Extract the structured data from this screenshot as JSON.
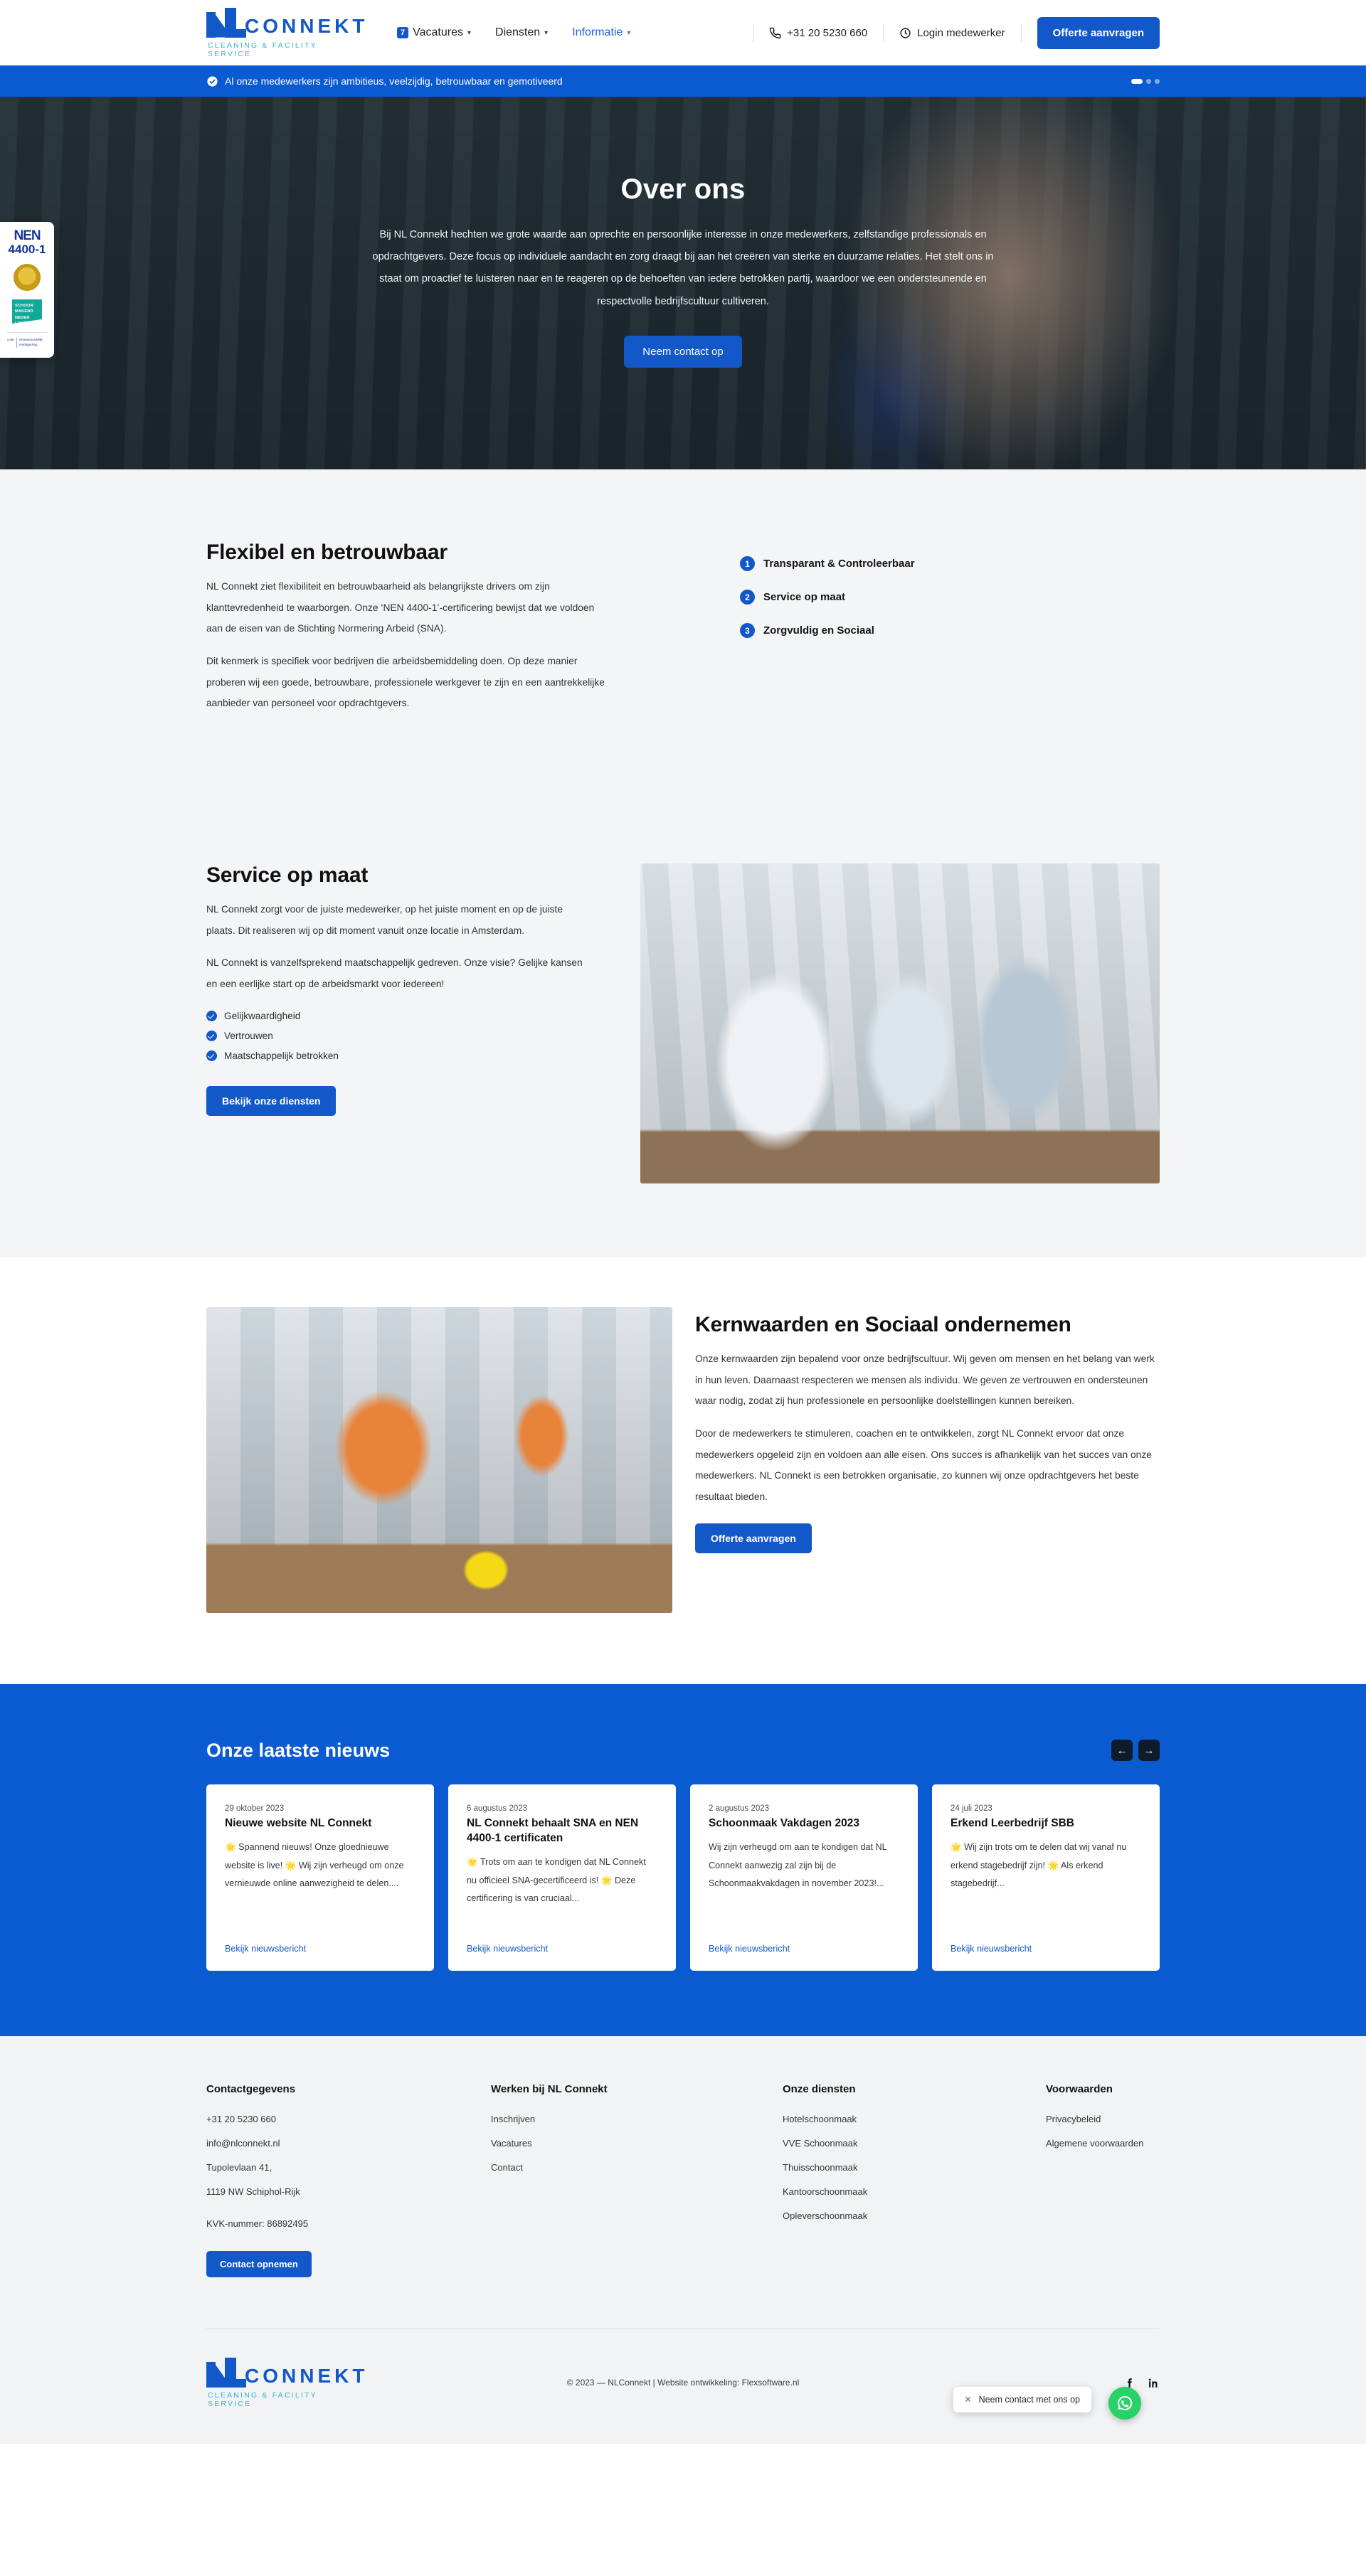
{
  "header": {
    "logo": {
      "word": "CONNEKT",
      "tagline": "CLEANING & FACILITY SERVICE"
    },
    "nav": [
      {
        "label": "Vacatures",
        "count": "7",
        "caret": "chevron-down-icon",
        "active": false
      },
      {
        "label": "Diensten",
        "count": "",
        "caret": "chevron-down-icon",
        "active": false
      },
      {
        "label": "Informatie",
        "count": "",
        "caret": "chevron-down-icon",
        "active": true
      }
    ],
    "phone": "+31 20 5230 660",
    "login": "Login medewerker",
    "cta": "Offerte aanvragen"
  },
  "banner": {
    "text": "Al onze medewerkers zijn ambitieus, veelzijdig, betrouwbaar en gemotiveerd",
    "dots": 3,
    "active_dot": 0
  },
  "cert": {
    "nen_line1": "NEN",
    "nen_line2": "4400-1",
    "teal": "SCHOON MAKEND NEDER LAND",
    "last_left": "code",
    "last_right": "verantwoordelijk marktgedrag"
  },
  "hero": {
    "title": "Over ons",
    "paragraph": "Bij NL Connekt hechten we grote waarde aan oprechte en persoonlijke interesse in onze medewerkers, zelfstandige professionals en opdrachtgevers. Deze focus op individuele aandacht en zorg draagt bij aan het creëren van sterke en duurzame relaties. Het stelt ons in staat om proactief te luisteren naar en te reageren op de behoeften van iedere betrokken partij, waardoor we een ondersteunende en respectvolle bedrijfscultuur cultiveren.",
    "button": "Neem contact op"
  },
  "flexibel": {
    "title": "Flexibel en betrouwbaar",
    "p1": "NL Connekt ziet flexibiliteit en betrouwbaarheid als belangrijkste drivers om zijn klanttevredenheid te waarborgen. Onze ‘NEN 4400-1’-certificering bewijst dat we voldoen aan de eisen van de Stichting Normering Arbeid (SNA).",
    "p2": "Dit kenmerk is specifiek voor bedrijven die arbeidsbemiddeling doen. Op deze manier proberen wij een goede, betrouwbare, professionele werkgever te zijn en een aantrekkelijke aanbieder van personeel voor opdrachtgevers.",
    "items": [
      {
        "num": "1",
        "label": "Transparant & Controleerbaar"
      },
      {
        "num": "2",
        "label": "Service op maat"
      },
      {
        "num": "3",
        "label": "Zorgvuldig en Sociaal"
      }
    ]
  },
  "service": {
    "title": "Service op maat",
    "p1": "NL Connekt zorgt voor de juiste medewerker, op het juiste moment en op de juiste plaats. Dit realiseren wij op dit moment vanuit onze locatie in Amsterdam.",
    "p2": "NL Connekt is vanzelfsprekend maatschappelijk gedreven. Onze visie? Gelijke kansen en een eerlijke start op de arbeidsmarkt voor iedereen!",
    "checks": [
      "Gelijkwaardigheid",
      "Vertrouwen",
      "Maatschappelijk betrokken"
    ],
    "button": "Bekijk onze diensten"
  },
  "kernwaarden": {
    "title": "Kernwaarden en Sociaal ondernemen",
    "p1": "Onze kernwaarden zijn bepalend voor onze bedrijfscultuur. Wij geven om mensen en het belang van werk in hun leven. Daarnaast respecteren we mensen als individu. We geven ze vertrouwen en ondersteunen waar nodig, zodat zij hun professionele en persoonlijke doelstellingen kunnen bereiken.",
    "p2": "Door de medewerkers te stimuleren, coachen en te ontwikkelen, zorgt NL Connekt ervoor dat onze medewerkers opgeleid zijn en voldoen aan alle eisen. Ons succes is afhankelijk van het succes van onze medewerkers. NL Connekt is een betrokken organisatie, zo kunnen wij onze opdrachtgevers het beste resultaat bieden.",
    "button": "Offerte aanvragen"
  },
  "news": {
    "title": "Onze laatste nieuws",
    "prev": "←",
    "next": "→",
    "link_label": "Bekijk nieuwsbericht",
    "cards": [
      {
        "date": "29 oktober 2023",
        "title": "Nieuwe website NL Connekt",
        "excerpt": "🌟 Spannend nieuws! Onze gloednieuwe website is live! 🌟 Wij zijn verheugd om onze vernieuwde online aanwezigheid te delen...."
      },
      {
        "date": "6 augustus 2023",
        "title": "NL Connekt behaalt SNA en NEN 4400-1 certificaten",
        "excerpt": "🌟 Trots om aan te kondigen dat NL Connekt nu officieel SNA-gecertificeerd is! 🌟 Deze certificering is van cruciaal..."
      },
      {
        "date": "2 augustus 2023",
        "title": "Schoonmaak Vakdagen 2023",
        "excerpt": "Wij zijn verheugd om aan te kondigen dat NL Connekt aanwezig zal zijn bij de Schoonmaakvakdagen in november 2023!..."
      },
      {
        "date": "24 juli 2023",
        "title": "Erkend Leerbedrijf SBB",
        "excerpt": "🌟 Wij zijn trots om te delen dat wij vanaf nu erkend stagebedrijf zijn! 🌟 Als erkend stagebedrijf..."
      }
    ]
  },
  "footer": {
    "contact": {
      "heading": "Contactgegevens",
      "phone": "+31 20 5230 660",
      "email": "info@nlconnekt.nl",
      "address1": "Tupolevlaan 41,",
      "address2": "1119 NW Schiphol-Rijk",
      "kvk": "KVK-nummer: 86892495",
      "button": "Contact opnemen"
    },
    "werken": {
      "heading": "Werken bij NL Connekt",
      "links": [
        "Inschrijven",
        "Vacatures",
        "Contact"
      ]
    },
    "diensten": {
      "heading": "Onze diensten",
      "links": [
        "Hotelschoonmaak",
        "VVE Schoonmaak",
        "Thuisschoonmaak",
        "Kantoorschoonmaak",
        "Opleverschoonmaak"
      ]
    },
    "voorwaarden": {
      "heading": "Voorwaarden",
      "links": [
        "Privacybeleid",
        "Algemene voorwaarden"
      ]
    },
    "copyright": "© 2023 —  NLConnekt | Website ontwikkeling: Flexsoftware.nl",
    "logo_word": "CONNEKT",
    "logo_tagline": "CLEANING & FACILITY SERVICE"
  },
  "chat": {
    "label": "Neem contact met ons op",
    "close": "✕"
  },
  "colors": {
    "brand_blue": "#1258c8",
    "banner_blue": "#0a5ad2",
    "teal": "#35b5c9",
    "whatsapp_green": "#25d366",
    "light_bg": "#f4f5f7"
  }
}
